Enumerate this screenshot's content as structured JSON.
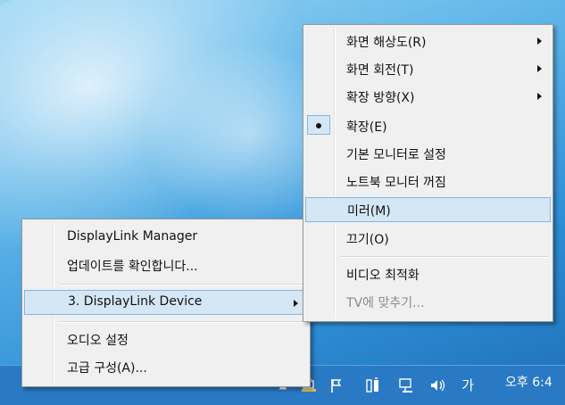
{
  "left_menu": {
    "items": [
      {
        "label": "DisplayLink Manager"
      },
      {
        "label": "업데이트를 확인합니다..."
      },
      {
        "label": "3. DisplayLink Device"
      },
      {
        "label": "오디오 설정"
      },
      {
        "label": "고급 구성(A)..."
      }
    ]
  },
  "right_menu": {
    "items": [
      {
        "label": "화면 해상도(R)"
      },
      {
        "label": "화면 회전(T)"
      },
      {
        "label": "확장 방향(X)"
      },
      {
        "label": "확장(E)"
      },
      {
        "label": "기본 모니터로 설정"
      },
      {
        "label": "노트북 모니터 꺼짐"
      },
      {
        "label": "미러(M)"
      },
      {
        "label": "끄기(O)"
      },
      {
        "label": "비디오 최적화"
      },
      {
        "label": "TV에 맞추기..."
      }
    ]
  },
  "taskbar": {
    "ime_label": "가",
    "clock": "오후 6:4"
  },
  "icons": {
    "show_hidden": "chevron-up-icon",
    "displaylink": "displaylink-icon",
    "flag": "action-center-flag-icon",
    "power": "power-icon",
    "network": "network-icon",
    "volume": "volume-icon"
  },
  "colors": {
    "highlight_fill": "#d5e6f5",
    "highlight_border": "#82b8e6",
    "menu_bg": "#f0f0f0",
    "taskbar": "#2a79c4"
  }
}
